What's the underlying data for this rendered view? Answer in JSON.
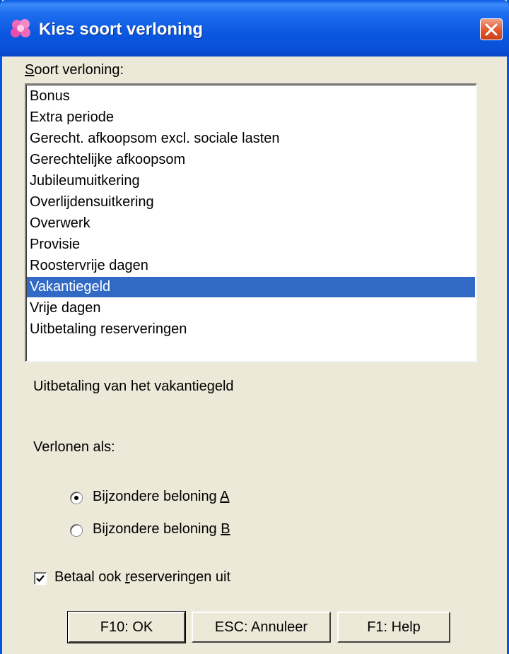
{
  "window": {
    "title": "Kies soort verloning",
    "close_icon": "close-icon"
  },
  "soort_label": {
    "accel": "S",
    "rest": "oort verloning:"
  },
  "list": {
    "items": [
      "Bonus",
      "Extra periode",
      "Gerecht. afkoopsom excl. sociale lasten",
      "Gerechtelijke afkoopsom",
      "Jubileumuitkering",
      "Overlijdensuitkering",
      "Overwerk",
      "Provisie",
      "Roostervrije dagen",
      "Vakantiegeld",
      "Vrije dagen",
      "Uitbetaling reserveringen"
    ],
    "selected": "Vakantiegeld",
    "selection_color": "#316ac5"
  },
  "description": "Uitbetaling van het vakantiegeld",
  "verlonen": {
    "label": "Verlonen als:",
    "option_a": {
      "text": "Bijzondere beloning ",
      "accel": "A",
      "checked": true
    },
    "option_b": {
      "text": "Bijzondere beloning ",
      "accel": "B",
      "checked": false
    }
  },
  "checkbox": {
    "before": "Betaal ook ",
    "accel": "r",
    "after": "eserveringen uit",
    "checked": true
  },
  "buttons": {
    "ok": "F10: OK",
    "cancel": "ESC: Annuleer",
    "help": "F1: Help"
  },
  "colors": {
    "title_bar": "#0b57e0",
    "window_bg": "#ece9d8",
    "close_button": "#e2572b"
  }
}
